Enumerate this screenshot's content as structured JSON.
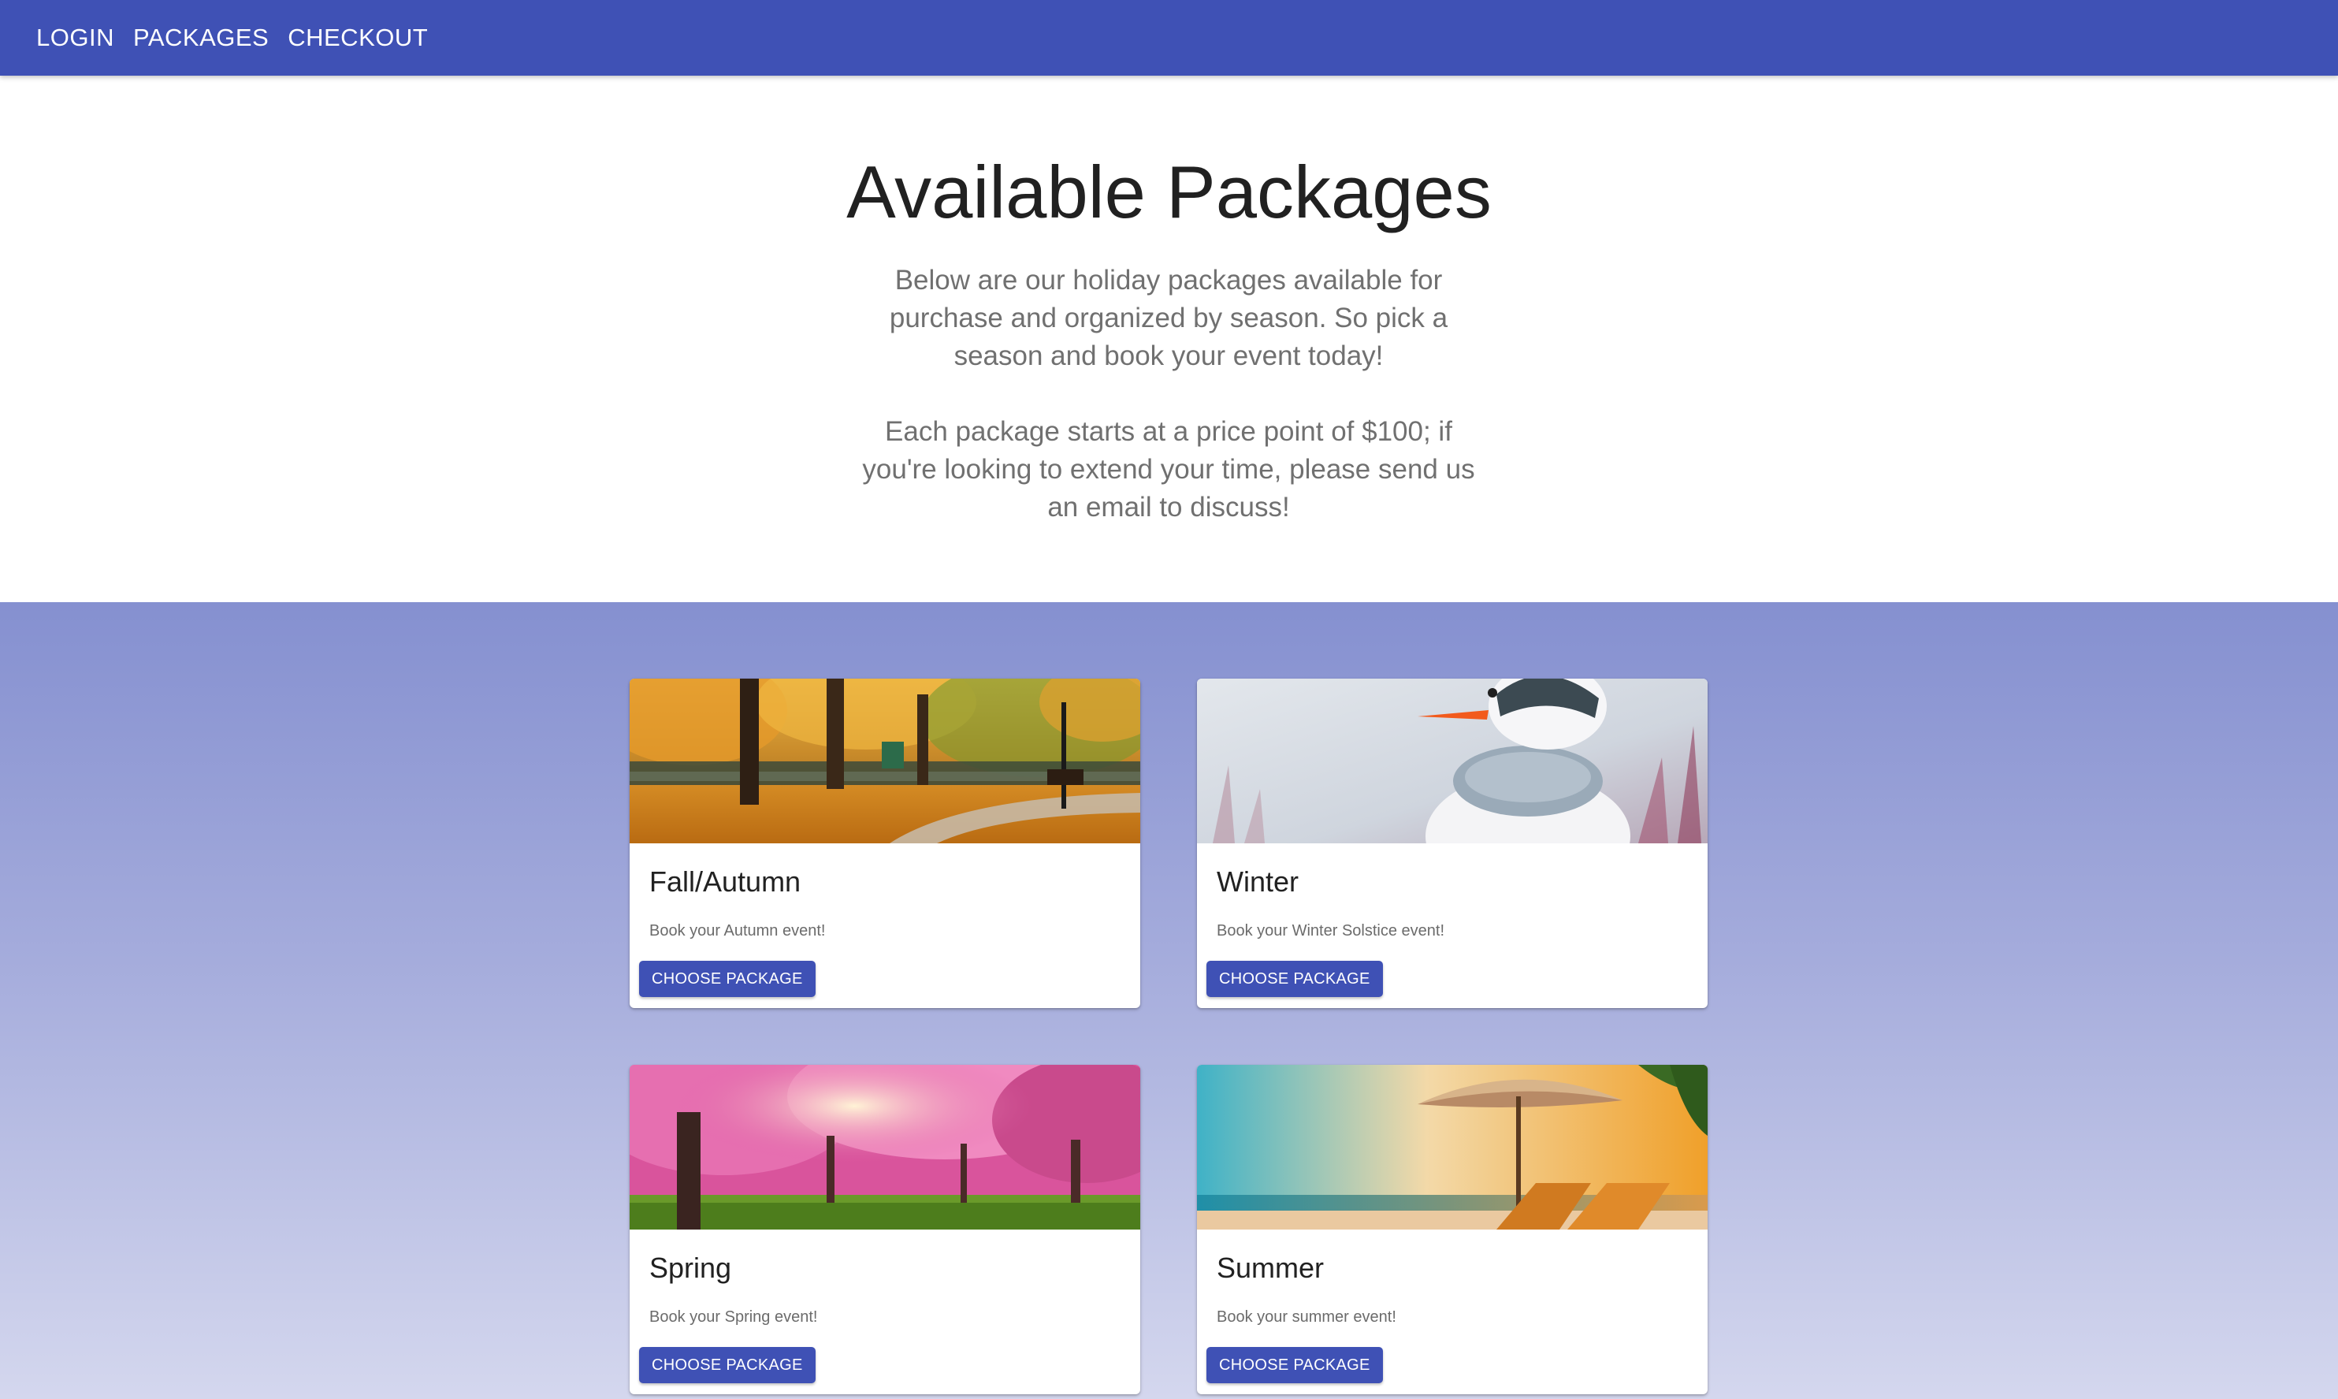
{
  "nav": {
    "items": [
      {
        "label": "LOGIN"
      },
      {
        "label": "PACKAGES"
      },
      {
        "label": "CHECKOUT"
      }
    ]
  },
  "hero": {
    "title": "Available Packages",
    "paragraph1": "Below are our holiday packages available for purchase and organized by season. So pick a season and book your event today!",
    "paragraph2": "Each package starts at a price point of $100; if you're looking to extend your time, please send us an email to discuss!"
  },
  "packages": [
    {
      "title": "Fall/Autumn",
      "description": "Book your Autumn event!",
      "button_label": "CHOOSE PACKAGE",
      "image": "autumn-park-image"
    },
    {
      "title": "Winter",
      "description": "Book your Winter Solstice event!",
      "button_label": "CHOOSE PACKAGE",
      "image": "snowman-image"
    },
    {
      "title": "Spring",
      "description": "Book your Spring event!",
      "button_label": "CHOOSE PACKAGE",
      "image": "cherry-blossom-image"
    },
    {
      "title": "Summer",
      "description": "Book your summer event!",
      "button_label": "CHOOSE PACKAGE",
      "image": "beach-umbrella-image"
    }
  ],
  "colors": {
    "primary": "#3f51b5",
    "title_text": "#212121",
    "body_text": "#707070"
  }
}
